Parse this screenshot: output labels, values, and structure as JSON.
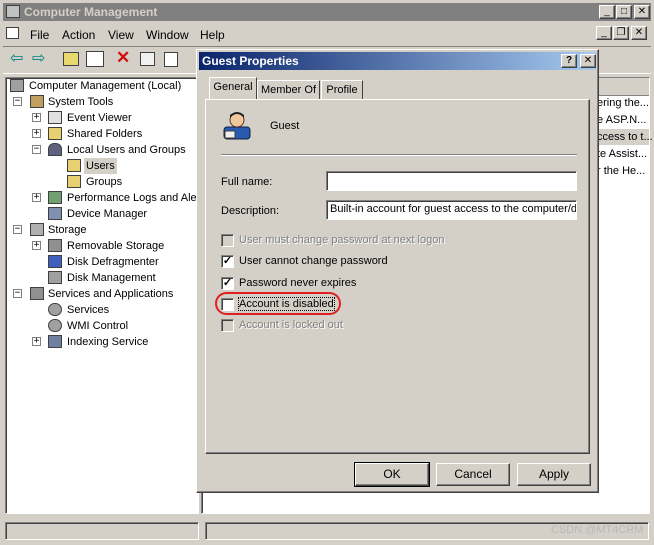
{
  "main_window": {
    "title": "Computer Management",
    "menu": [
      "File",
      "Action",
      "View",
      "Window",
      "Help"
    ]
  },
  "tree": {
    "root": "Computer Management (Local)",
    "items": [
      {
        "label": "System Tools",
        "icon": "tools-icon"
      },
      {
        "label": "Event Viewer",
        "icon": "event-viewer-icon"
      },
      {
        "label": "Shared Folders",
        "icon": "shared-folders-icon"
      },
      {
        "label": "Local Users and Groups",
        "icon": "users-groups-icon"
      },
      {
        "label": "Users",
        "icon": "folder-open-icon"
      },
      {
        "label": "Groups",
        "icon": "folder-icon"
      },
      {
        "label": "Performance Logs and Aler",
        "icon": "perf-logs-icon"
      },
      {
        "label": "Device Manager",
        "icon": "device-manager-icon"
      },
      {
        "label": "Storage",
        "icon": "storage-icon"
      },
      {
        "label": "Removable Storage",
        "icon": "removable-storage-icon"
      },
      {
        "label": "Disk Defragmenter",
        "icon": "defrag-icon"
      },
      {
        "label": "Disk Management",
        "icon": "disk-management-icon"
      },
      {
        "label": "Services and Applications",
        "icon": "services-apps-icon"
      },
      {
        "label": "Services",
        "icon": "services-icon"
      },
      {
        "label": "WMI Control",
        "icon": "wmi-icon"
      },
      {
        "label": "Indexing Service",
        "icon": "indexing-icon"
      }
    ]
  },
  "right_pane_fragments": [
    "ering the...",
    "e ASP.N...",
    "ccess to t...",
    "te Assist...",
    "r the He..."
  ],
  "dialog": {
    "title": "Guest Properties",
    "tabs": [
      "General",
      "Member Of",
      "Profile"
    ],
    "user_name": "Guest",
    "full_name_label": "Full name:",
    "full_name_value": "",
    "description_label": "Description:",
    "description_value": "Built-in account for guest access to the computer/domain",
    "checkboxes": [
      {
        "label": "User must change password at next logon",
        "checked": false,
        "enabled": false
      },
      {
        "label": "User cannot change password",
        "checked": true,
        "enabled": true
      },
      {
        "label": "Password never expires",
        "checked": true,
        "enabled": true
      },
      {
        "label": "Account is disabled",
        "checked": false,
        "enabled": true
      },
      {
        "label": "Account is locked out",
        "checked": false,
        "enabled": false
      }
    ],
    "buttons": {
      "ok": "OK",
      "cancel": "Cancel",
      "apply": "Apply"
    },
    "help_glyph": "?",
    "close_glyph": "✕"
  },
  "watermark": "CSDN @MT4CRM",
  "colors": {
    "highlight_ring": "#e02020",
    "title_active": "#0a246a",
    "title_inactive": "#808080"
  }
}
